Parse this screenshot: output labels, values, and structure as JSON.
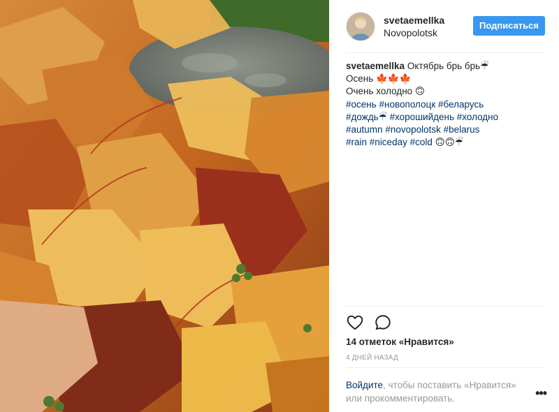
{
  "post": {
    "photo_description_icon": "autumn-leaves-photo",
    "author": {
      "username": "svetaemellka",
      "location": "Novopolotsk",
      "follow_label": "Подписаться"
    },
    "caption": {
      "username": "svetaemellka",
      "line1_text": " Октябрь брь брь☔",
      "line2_text": "Осень 🍁🍁🍁",
      "line3_text": "Очень холодно 🙃",
      "hashtags": {
        "t1": "#осень",
        "t2": "#новополоцк",
        "t3": "#беларусь",
        "t4": "#дождь☔",
        "t5": "#хорошийдень",
        "t6": "#холодно",
        "t7": "#autumn",
        "t8": "#novopolotsk",
        "t9": "#belarus",
        "t10": "#rain",
        "t11": "#niceday",
        "t12": "#cold",
        "tail": " 🙃🙃☔"
      }
    },
    "likes_text": "14 отметок «Нравится»",
    "time_ago": "4 ДНЕЙ НАЗАД",
    "login_prompt": {
      "link": "Войдите",
      "rest": ", чтобы поставить «Нравится» или прокомментировать."
    },
    "more_label": "•••"
  },
  "colors": {
    "accent": "#3897f0",
    "link": "#003569",
    "muted": "#999999"
  }
}
